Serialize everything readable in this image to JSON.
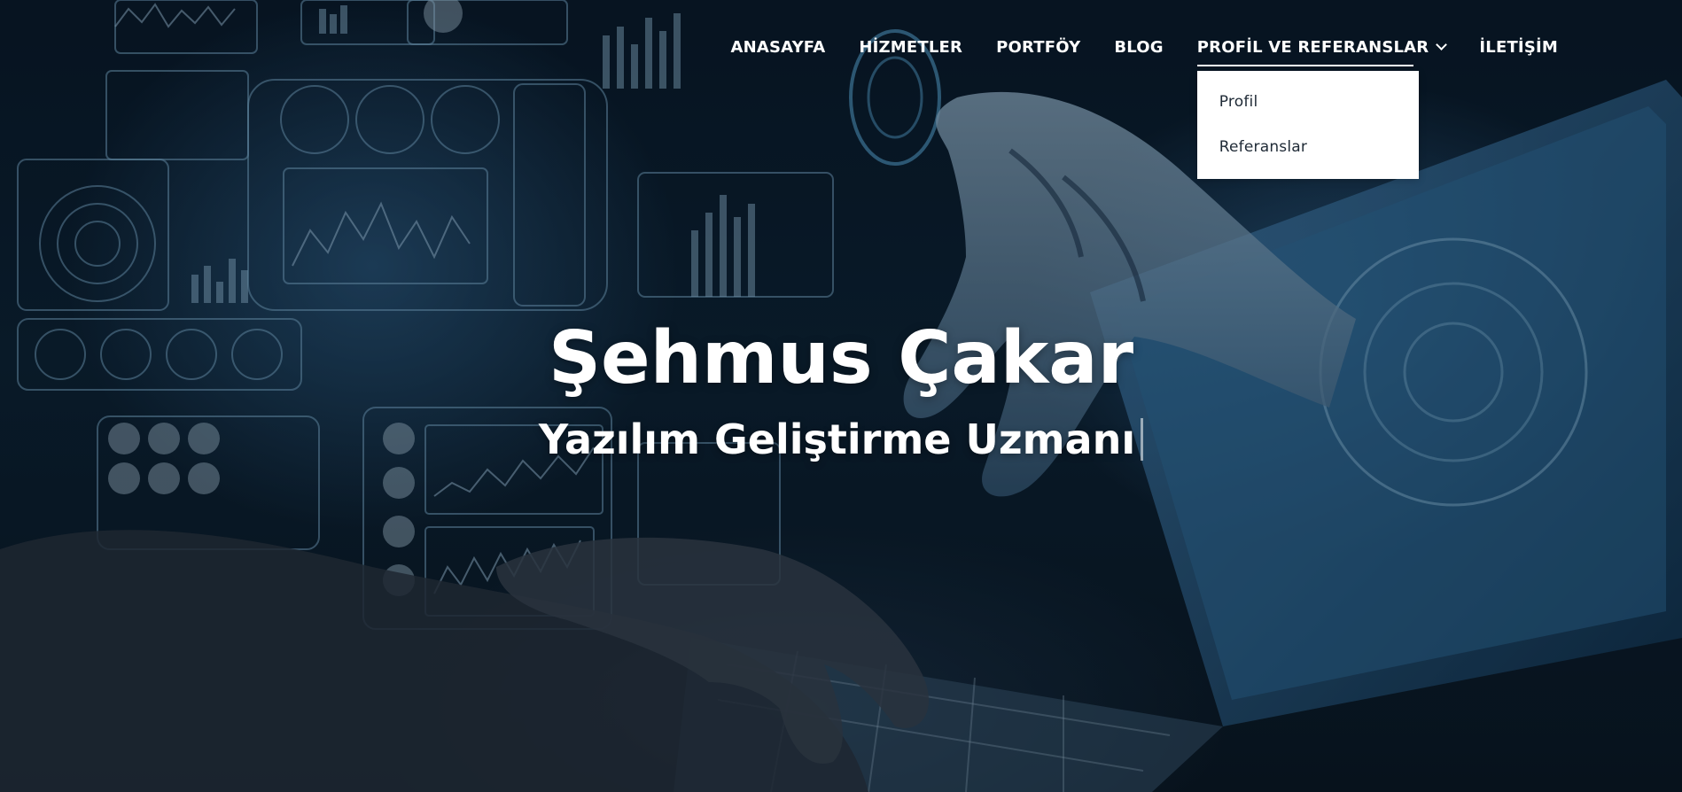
{
  "nav": {
    "items": [
      {
        "label": "ANASAYFA"
      },
      {
        "label": "HİZMETLER"
      },
      {
        "label": "PORTFÖY"
      },
      {
        "label": "BLOG"
      },
      {
        "label": "PROFİL VE REFERANSLAR"
      },
      {
        "label": "İLETİŞİM"
      }
    ],
    "dropdown": {
      "items": [
        {
          "label": "Profil"
        },
        {
          "label": "Referanslar"
        }
      ]
    }
  },
  "hero": {
    "name": "Şehmus Çakar",
    "subtitle": "Yazılım Geliştirme Uzmanı"
  },
  "colors": {
    "nav_text": "#ffffff",
    "dropdown_bg": "#ffffff",
    "dropdown_text": "#1f2a36",
    "background_tint": "#0d2438"
  },
  "icons": {
    "dropdown_indicator": "chevron-down-icon"
  }
}
